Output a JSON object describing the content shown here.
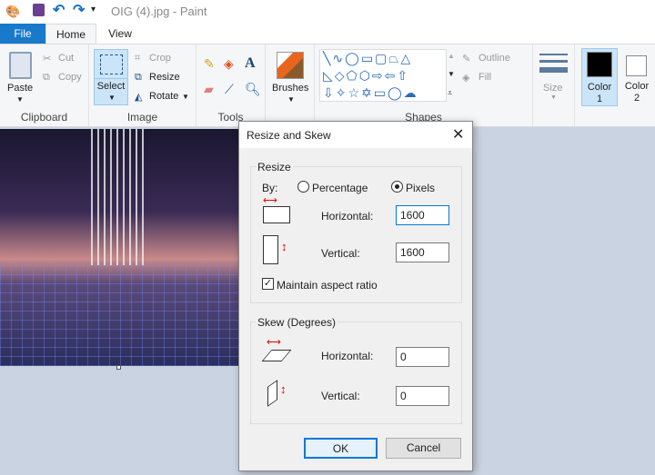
{
  "window": {
    "title": "OIG (4).jpg - Paint"
  },
  "tabs": [
    {
      "label": "File"
    },
    {
      "label": "Home"
    },
    {
      "label": "View"
    }
  ],
  "ribbon": {
    "clipboard": {
      "label": "Clipboard",
      "paste": "Paste",
      "cut": "Cut",
      "copy": "Copy"
    },
    "image": {
      "label": "Image",
      "select": "Select",
      "crop": "Crop",
      "resize": "Resize",
      "rotate": "Rotate"
    },
    "tools": {
      "label": "Tools"
    },
    "brushes": {
      "label": "Brushes"
    },
    "shapes": {
      "label": "Shapes",
      "outline": "Outline",
      "fill": "Fill"
    },
    "size": {
      "label": "Size"
    },
    "color1": {
      "label": "Color",
      "num": "1",
      "value": "#000000"
    },
    "color2": {
      "label": "Color",
      "num": "2",
      "value": "#ffffff"
    }
  },
  "dialog": {
    "title": "Resize and Skew",
    "resize": {
      "label": "Resize",
      "by": "By:",
      "percentage": "Percentage",
      "pixels": "Pixels",
      "selected": "Pixels",
      "horizontal_label": "Horizontal:",
      "horizontal": "1600",
      "vertical_label": "Vertical:",
      "vertical": "1600",
      "maintain": "Maintain aspect ratio",
      "maintain_checked": true
    },
    "skew": {
      "label": "Skew (Degrees)",
      "horizontal_label": "Horizontal:",
      "horizontal": "0",
      "vertical_label": "Vertical:",
      "vertical": "0"
    },
    "ok": "OK",
    "cancel": "Cancel"
  }
}
